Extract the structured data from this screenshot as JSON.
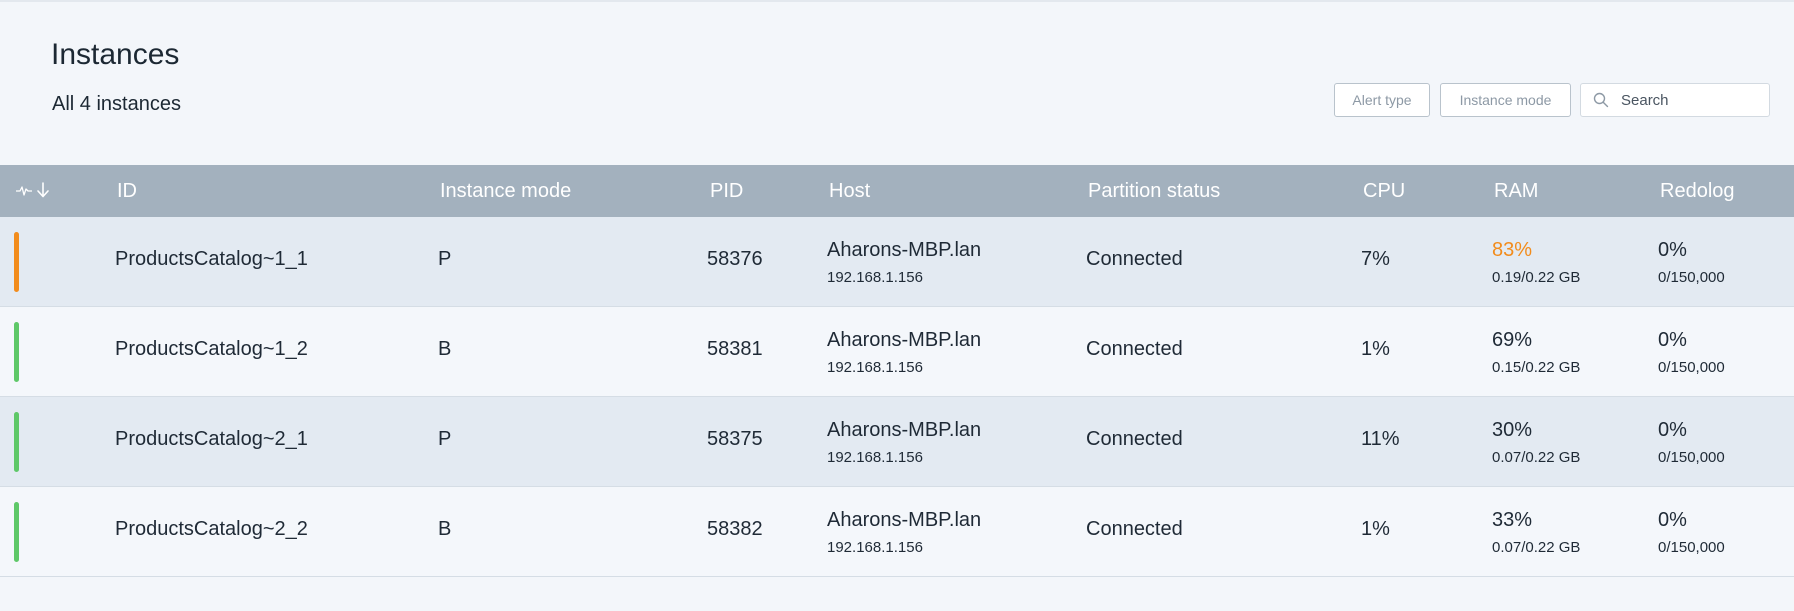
{
  "header": {
    "title": "Instances",
    "subtitle": "All 4 instances",
    "alert_type_label": "Alert type",
    "instance_mode_label": "Instance mode",
    "search_placeholder": "Search"
  },
  "colors": {
    "warning": "#f28c1c",
    "ok": "#5ec868",
    "header_bg": "#a3b1be"
  },
  "table": {
    "columns": {
      "id": "ID",
      "instance_mode": "Instance mode",
      "pid": "PID",
      "host": "Host",
      "partition_status": "Partition status",
      "cpu": "CPU",
      "ram": "RAM",
      "redolog": "Redolog"
    },
    "sort_icons": [
      "pulse-icon",
      "arrow-down-icon"
    ],
    "rows": [
      {
        "status": "warning",
        "id": "ProductsCatalog~1_1",
        "mode": "P",
        "pid": "58376",
        "host": "Aharons-MBP.lan",
        "ip": "192.168.1.156",
        "partition": "Connected",
        "cpu": "7%",
        "ram": "83%",
        "ram_detail": "0.19/0.22 GB",
        "redolog": "0%",
        "redolog_detail": "0/150,000"
      },
      {
        "status": "ok",
        "id": "ProductsCatalog~1_2",
        "mode": "B",
        "pid": "58381",
        "host": "Aharons-MBP.lan",
        "ip": "192.168.1.156",
        "partition": "Connected",
        "cpu": "1%",
        "ram": "69%",
        "ram_detail": "0.15/0.22 GB",
        "redolog": "0%",
        "redolog_detail": "0/150,000"
      },
      {
        "status": "ok",
        "id": "ProductsCatalog~2_1",
        "mode": "P",
        "pid": "58375",
        "host": "Aharons-MBP.lan",
        "ip": "192.168.1.156",
        "partition": "Connected",
        "cpu": "11%",
        "ram": "30%",
        "ram_detail": "0.07/0.22 GB",
        "redolog": "0%",
        "redolog_detail": "0/150,000"
      },
      {
        "status": "ok",
        "id": "ProductsCatalog~2_2",
        "mode": "B",
        "pid": "58382",
        "host": "Aharons-MBP.lan",
        "ip": "192.168.1.156",
        "partition": "Connected",
        "cpu": "1%",
        "ram": "33%",
        "ram_detail": "0.07/0.22 GB",
        "redolog": "0%",
        "redolog_detail": "0/150,000"
      }
    ]
  }
}
